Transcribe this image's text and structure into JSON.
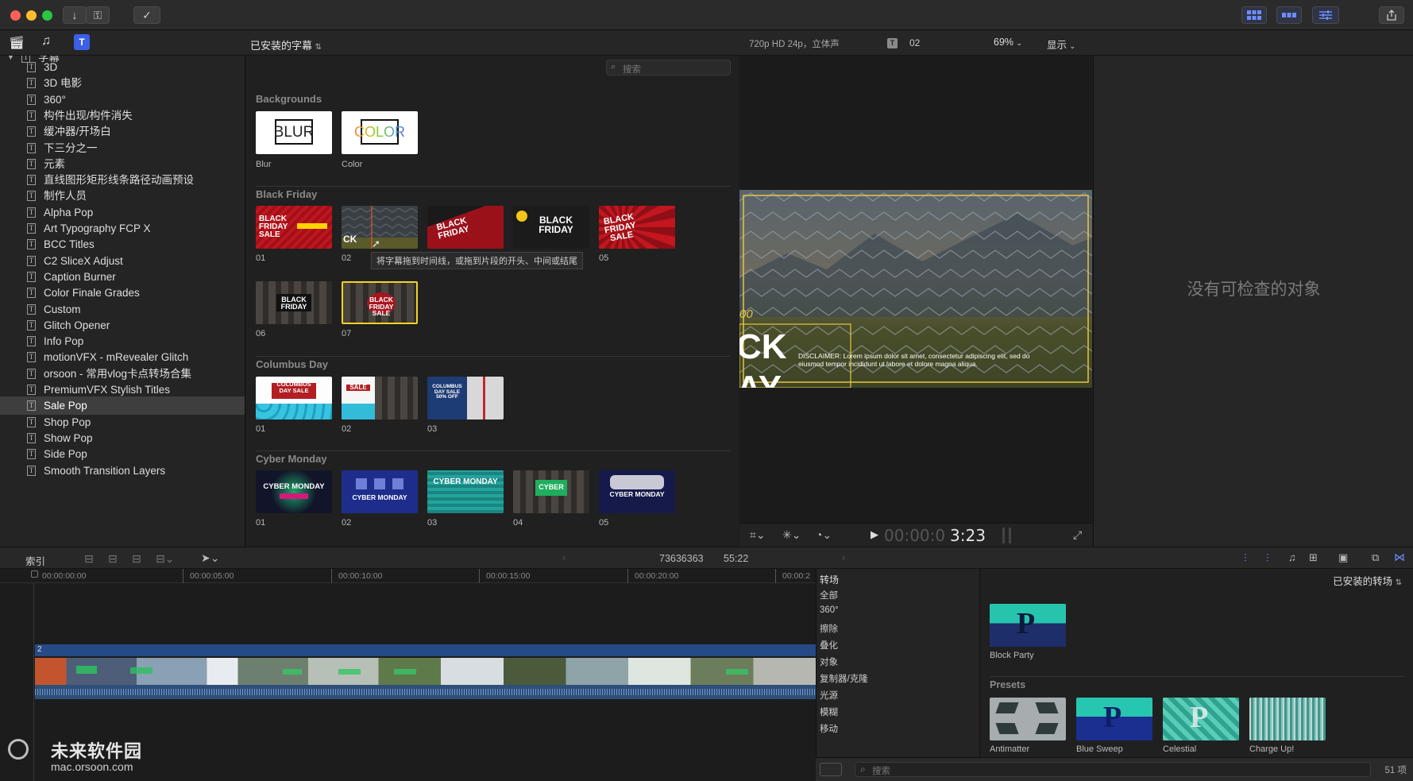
{
  "toolbar": {
    "window_colors": [
      "#fe5f57",
      "#febc2e",
      "#28c840"
    ],
    "import_icon": "↓",
    "keyword_icon": "⚿",
    "check_icon": "✓"
  },
  "library": {
    "title": "已安装的字幕",
    "root": "字幕",
    "search_placeholder": "搜索",
    "items": [
      "3D",
      "3D 电影",
      "360°",
      "构件出现/构件消失",
      "缓冲器/开场白",
      "下三分之一",
      "元素",
      "直线图形矩形线条路径动画预设",
      "制作人员",
      "Alpha Pop",
      "Art Typography FCP X",
      "BCC Titles",
      "C2 SliceX Adjust",
      "Caption Burner",
      "Color Finale Grades",
      "Custom",
      "Glitch Opener",
      "Info Pop",
      "motionVFX - mRevealer Glitch",
      "orsoon - 常用vlog卡点转场合集",
      "PremiumVFX Stylish Titles",
      "Sale Pop",
      "Shop Pop",
      "Show Pop",
      "Side Pop",
      "Smooth Transition Layers"
    ],
    "selected_index": 21
  },
  "browser": {
    "tooltip": "将字幕拖到时间线，或拖到片段的开头、中间或结尾",
    "sections": [
      {
        "title": "Backgrounds",
        "items": [
          {
            "label": "Blur",
            "text": "BLUR"
          },
          {
            "label": "Color",
            "text": "COLOR"
          }
        ]
      },
      {
        "title": "Black Friday",
        "items": [
          {
            "label": "01",
            "text": "BLACK FRIDAY SALE"
          },
          {
            "label": "02",
            "text": "CK"
          },
          {
            "label": "",
            "text": "BLACK FRIDAY"
          },
          {
            "label": "",
            "text": "BLACK FRIDAY"
          },
          {
            "label": "05",
            "text": "BLACK FRIDAY SALE"
          },
          {
            "label": "06",
            "text": "BLACK FRIDAY"
          },
          {
            "label": "07",
            "text": "BLACK FRIDAY SALE"
          }
        ]
      },
      {
        "title": "Columbus Day",
        "items": [
          {
            "label": "01",
            "text": "COLUMBUS DAY SALE"
          },
          {
            "label": "02",
            "text": "SALE"
          },
          {
            "label": "03",
            "text": "COLUMBUS DAY SALE 50% OFF"
          }
        ]
      },
      {
        "title": "Cyber Monday",
        "items": [
          {
            "label": "01",
            "text": "CYBER MONDAY"
          },
          {
            "label": "02",
            "text": "CYBER MONDAY"
          },
          {
            "label": "03",
            "text": "CYBER MONDAY"
          },
          {
            "label": "04",
            "text": "CYBER"
          },
          {
            "label": "05",
            "text": "CYBER MONDAY"
          }
        ]
      }
    ]
  },
  "viewer": {
    "format": "720p HD 24p，立体声",
    "clip_name": "02",
    "zoom": "69%",
    "display": "显示",
    "overlay_big": "CK",
    "overlay_big2": "AY",
    "overlay_small": "00",
    "disclaimer": "DISCLAIMER: Lorem ipsum dolor sit amet, consectetur adipiscing elit, sed do eiusmod tempor incididunt ut labore et dolore magna aliqua.",
    "timecode_dim": "00:00:0",
    "timecode_bright": "3:23"
  },
  "inspector": {
    "empty_text": "没有可检查的对象"
  },
  "timeline": {
    "index_label": "索引",
    "counter": "73636363",
    "duration": "55:22",
    "ruler": [
      "00:00:00:00",
      "00:00:05:00",
      "00:00:10:00",
      "00:00:15:00",
      "00:00:20:00",
      "00:00:2"
    ],
    "lane_label": "2"
  },
  "transitions": {
    "title": "转场",
    "installed": "已安装的转场",
    "categories": [
      "全部",
      "360°",
      "擦除",
      "叠化",
      "对象",
      "复制器/克隆",
      "光源",
      "模糊",
      "移动"
    ],
    "featured": {
      "label": "Block Party"
    },
    "presets_title": "Presets",
    "presets": [
      "Antimatter",
      "Blue Sweep",
      "Celestial",
      "Charge Up!"
    ],
    "search_placeholder": "搜索",
    "count": "51 项"
  },
  "watermark": {
    "name": "未来软件园",
    "url": "mac.orsoon.com"
  }
}
